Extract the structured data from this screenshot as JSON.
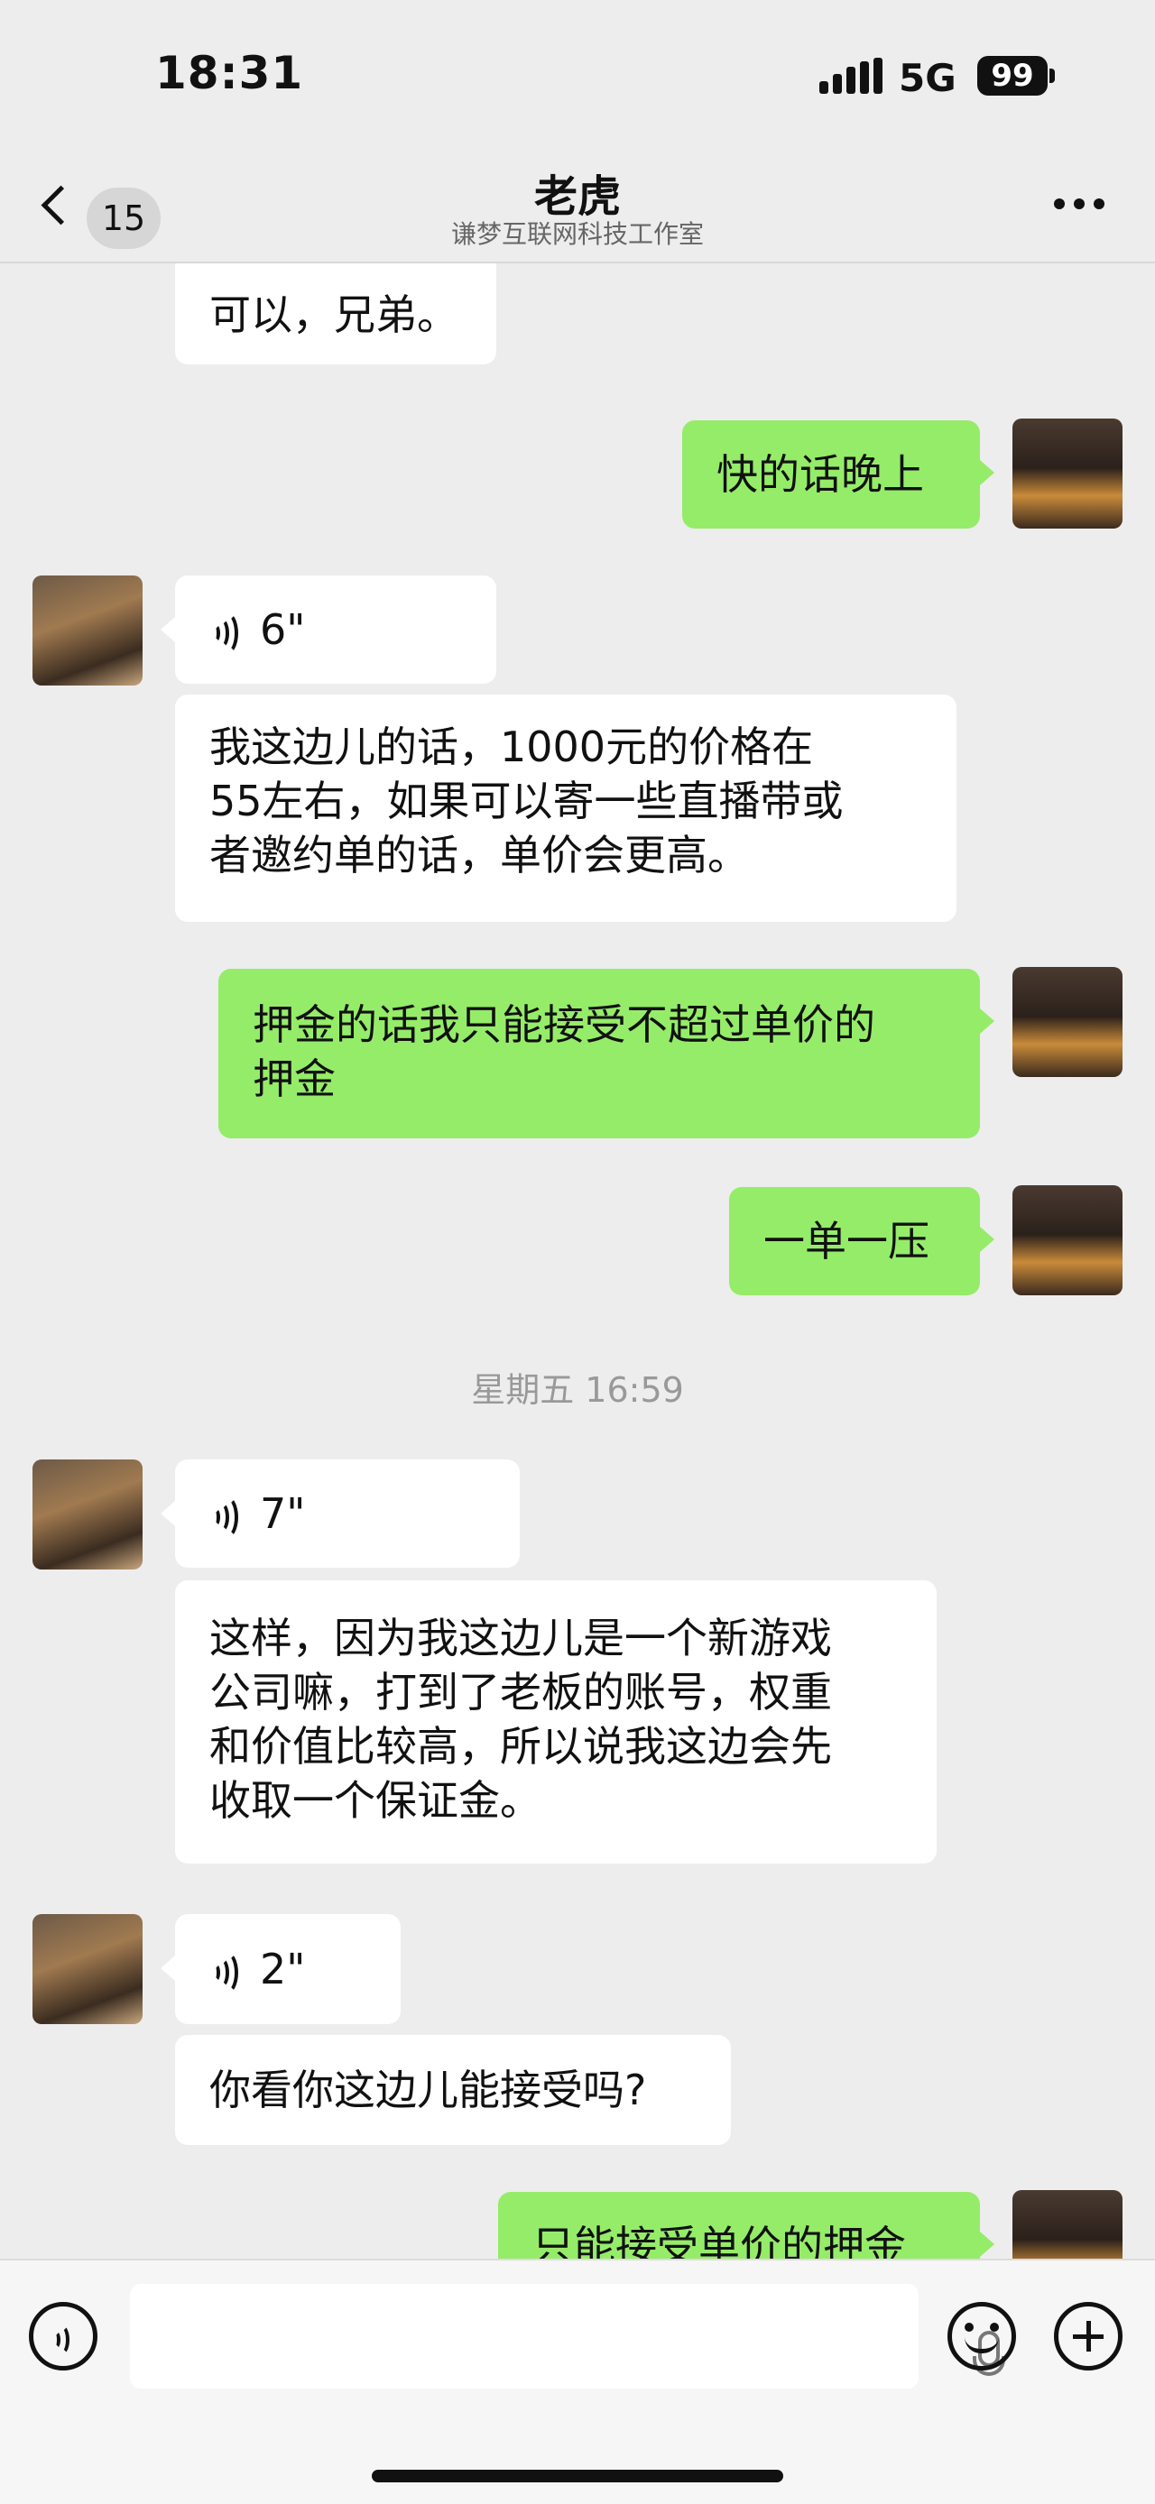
{
  "status_bar": {
    "time": "18:31",
    "network": "5G",
    "battery": "99"
  },
  "header": {
    "unread_count": "15",
    "title": "老虎",
    "subtitle": "谦梦互联网科技工作室"
  },
  "messages": {
    "m1": {
      "text": "可以，兄弟。"
    },
    "m2": {
      "text": "快的话晚上"
    },
    "m3": {
      "duration": "6\""
    },
    "m4": {
      "line1": "我这边儿的话，1000元的价格在",
      "line2": "55左右，如果可以寄一些直播带或",
      "line3": "者邀约单的话，单价会更高。"
    },
    "m5": {
      "line1": "押金的话我只能接受不超过单价的",
      "line2": "押金"
    },
    "m6": {
      "text": "一单一压"
    },
    "timestamp": "星期五 16:59",
    "m7": {
      "duration": "7\""
    },
    "m8": {
      "line1": "这样，因为我这边儿是一个新游戏",
      "line2": "公司嘛，打到了老板的账号，权重",
      "line3": "和价值比较高，所以说我这边会先",
      "line4": "收取一个保证金。"
    },
    "m9": {
      "duration": "2\""
    },
    "m10": {
      "text": "你看你这边儿能接受吗?"
    },
    "m11": {
      "text": "只能接受单价的押金"
    }
  },
  "icons": {
    "back": "chevron-left-icon",
    "more": "more-dots-icon",
    "voice": "voice-wave-icon",
    "mic": "microphone-icon",
    "emoji": "emoji-icon",
    "add": "plus-icon"
  },
  "colors": {
    "incoming_bubble": "#ffffff",
    "outgoing_bubble": "#95ec69",
    "background": "#ededed"
  }
}
